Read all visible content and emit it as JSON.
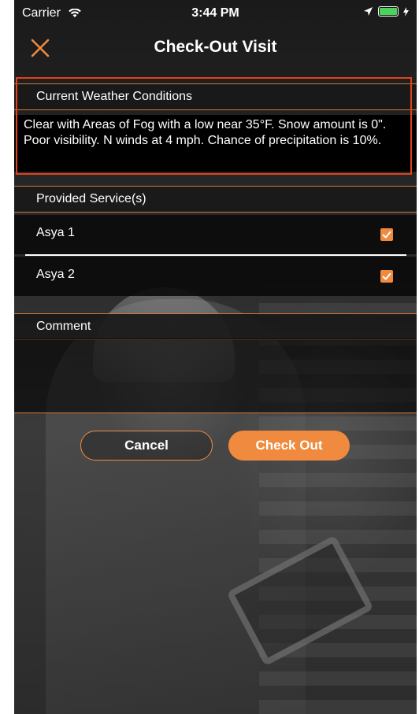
{
  "status_bar": {
    "carrier": "Carrier",
    "time": "3:44 PM"
  },
  "nav": {
    "title": "Check-Out Visit",
    "close_icon": "close-icon"
  },
  "weather": {
    "header": "Current Weather Conditions",
    "text": "Clear with Areas of Fog with a low near 35°F. Snow amount is 0\". Poor visibility. N winds at 4 mph. Chance of precipitation is 10%."
  },
  "services": {
    "header": "Provided Service(s)",
    "items": [
      {
        "label": "Asya 1",
        "checked": true
      },
      {
        "label": "Asya 2",
        "checked": true
      }
    ]
  },
  "comment": {
    "header": "Comment",
    "value": ""
  },
  "buttons": {
    "cancel": "Cancel",
    "check_out": "Check Out"
  },
  "colors": {
    "accent": "#f08a3e",
    "highlight_border": "#e0431b",
    "background": "#1e1e1e"
  }
}
